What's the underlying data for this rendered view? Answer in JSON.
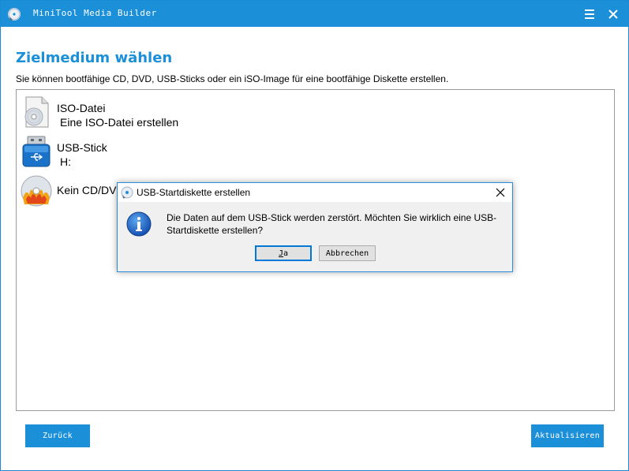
{
  "window": {
    "title": "MiniTool Media Builder",
    "accent_color": "#1b8fd8",
    "menu_icon": "hamburger-icon",
    "close_icon": "close-icon"
  },
  "page": {
    "heading": "Zielmedium wählen",
    "description": "Sie können bootfähige CD, DVD, USB-Sticks oder ein iSO-Image für eine bootfähige Diskette erstellen."
  },
  "targets": [
    {
      "title": "ISO-Datei",
      "subtitle": "Eine ISO-Datei erstellen",
      "icon": "disc-file-icon"
    },
    {
      "title": "USB-Stick",
      "subtitle": "H:",
      "icon": "usb-drive-icon"
    },
    {
      "title": "Kein CD/DVD",
      "subtitle": "",
      "icon": "burning-disc-icon"
    }
  ],
  "buttons": {
    "back": "Zurück",
    "refresh": "Aktualisieren"
  },
  "dialog": {
    "title": "USB-Startdiskette erstellen",
    "message": "Die Daten auf dem USB-Stick werden zerstört. Möchten Sie wirklich eine USB-Startdiskette erstellen?",
    "yes": "Ja",
    "cancel": "Abbrechen",
    "icon": "info-icon"
  }
}
